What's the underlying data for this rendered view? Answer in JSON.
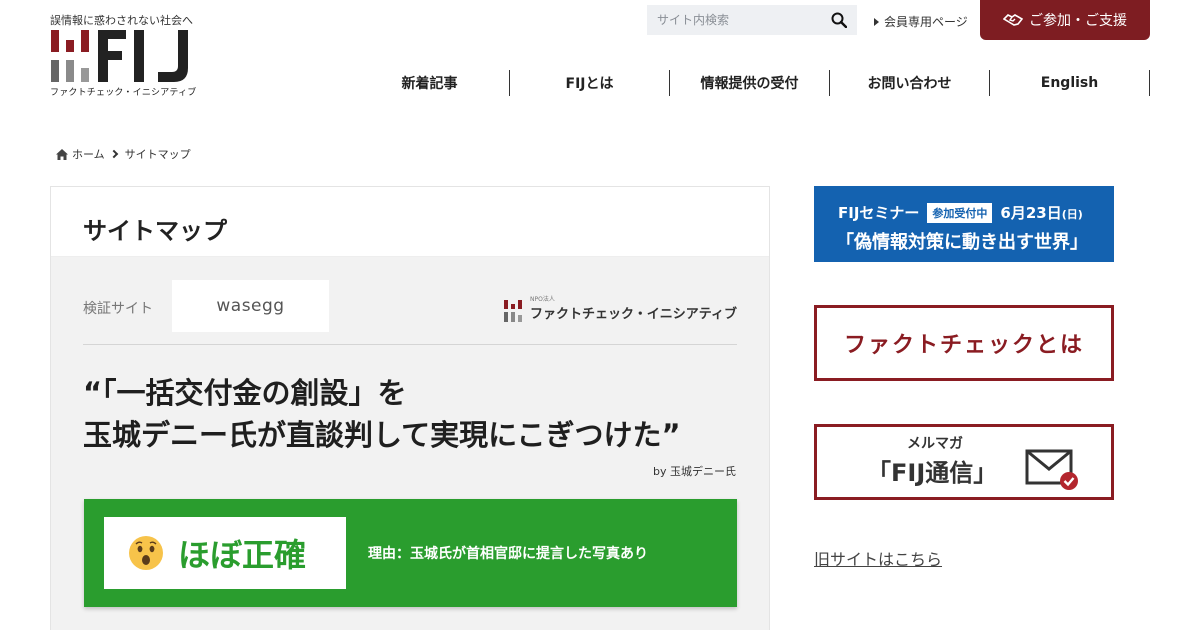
{
  "header": {
    "tagline": "誤情報に惑わされない社会へ",
    "logo_text": "FIJ",
    "logo_subtitle": "ファクトチェック・イニシアティブ",
    "search": {
      "placeholder": "サイト内検索",
      "value": ""
    },
    "member_link": "会員専用ページ",
    "join_button": "ご参加・ご支援",
    "nav": [
      "新着記事",
      "FIJとは",
      "情報提供の受付",
      "お問い合わせ",
      "English"
    ]
  },
  "breadcrumb": {
    "home": "ホーム",
    "current": "サイトマップ"
  },
  "main": {
    "page_title": "サイトマップ",
    "verify_label": "検証サイト",
    "verifier_logo": "wasegg",
    "npo_label": "NPO法人",
    "npo_name": "ファクトチェック・イニシアティブ",
    "claim_line1": "“「一括交付金の創設」を",
    "claim_line2": "玉城デニー氏が直談判して実現にこぎつけた”",
    "claim_by": "by 玉城デニー氏",
    "verdict": "ほぼ正確",
    "reason": "理由：玉城氏が首相官邸に提言した写真あり"
  },
  "sidebar": {
    "seminar_title": "FIJセミナー",
    "seminar_badge": "参加受付中",
    "seminar_date": "6月23日",
    "seminar_weekday": "(日)",
    "seminar_subtitle": "「偽情報対策に動き出す世界」",
    "factcheck_banner": "ファクトチェックとは",
    "newsletter_small": "メルマガ",
    "newsletter_main": "「FIJ通信」",
    "old_site_link": "旧サイトはこちら"
  },
  "colors": {
    "brand_red": "#7e1d22",
    "verdict_green": "#2a9d2e",
    "banner_blue": "#1462b0"
  }
}
